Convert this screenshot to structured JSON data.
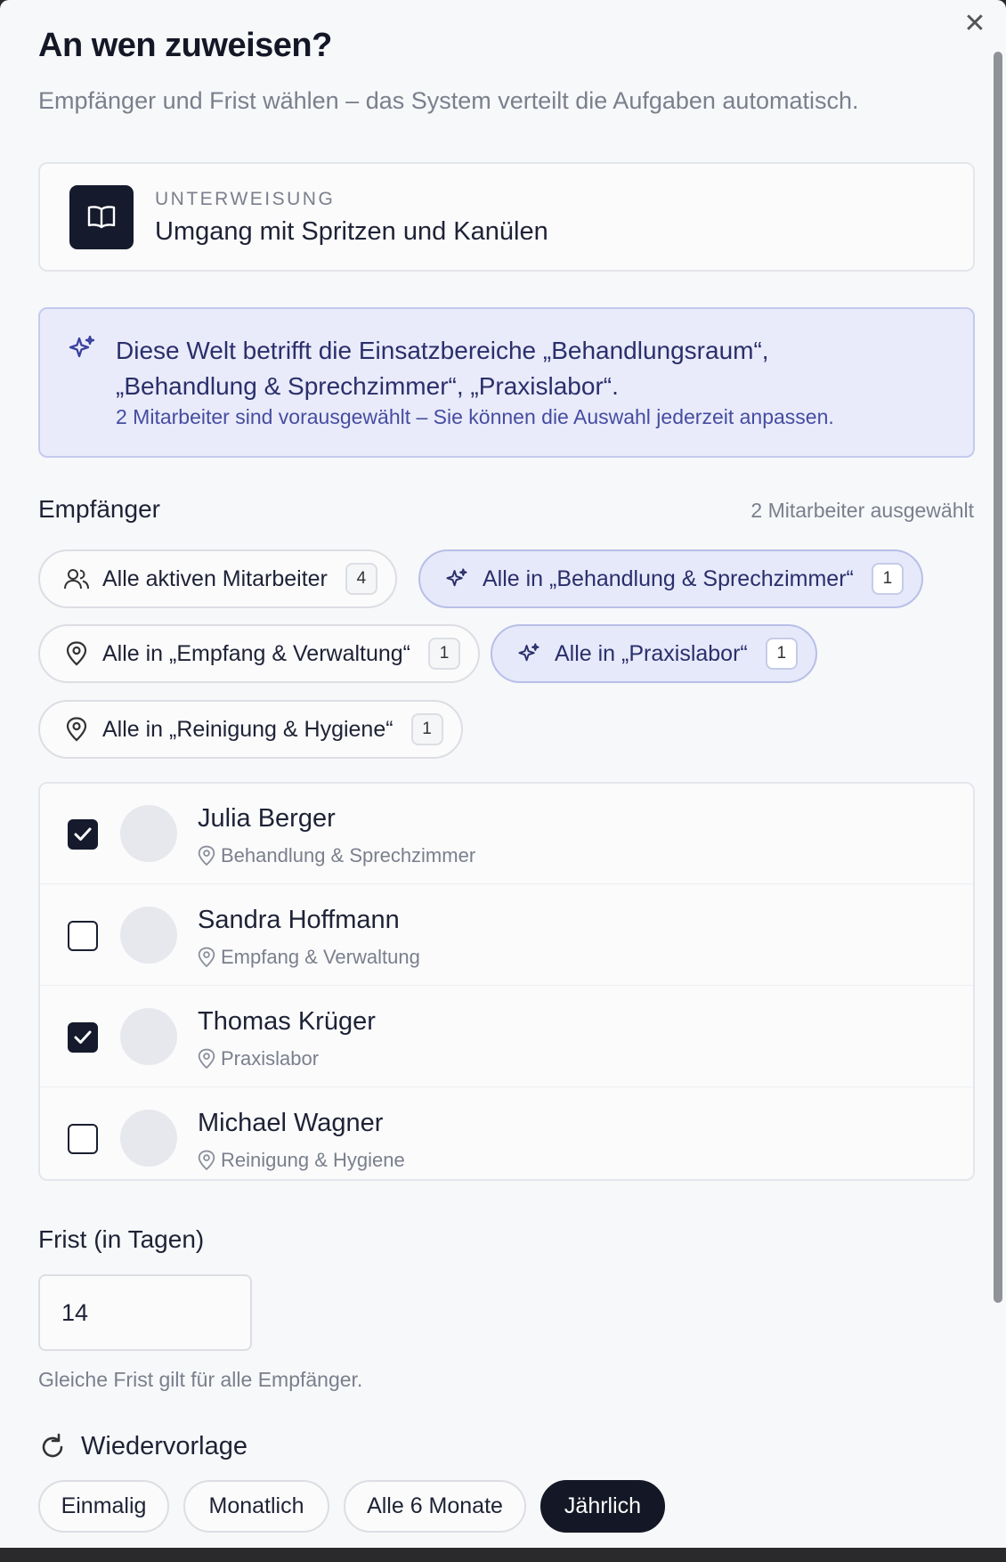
{
  "dialog": {
    "title": "An wen zuweisen?",
    "subtitle": "Empfänger und Frist wählen – das System verteilt die Aufgaben automatisch.",
    "close_icon": "close-icon"
  },
  "course": {
    "type": "UNTERWEISUNG",
    "name": "Umgang mit Spritzen und Kanülen",
    "icon": "book-open-icon"
  },
  "info": {
    "line1": "Diese Welt betrifft die Einsatzbereiche „Behandlungsraum“, „Behandlung & Sprechzimmer“, „Praxislabor“.",
    "line2": "2 Mitarbeiter sind vorausgewählt – Sie können die Auswahl jederzeit anpassen.",
    "icon": "sparkles-icon"
  },
  "recipients": {
    "label": "Empfänger",
    "selected_count": "2 Mitarbeiter ausgewählt",
    "chips": [
      {
        "label": "Alle aktiven Mitarbeiter",
        "count": "4",
        "icon": "users-icon",
        "active": false
      },
      {
        "label": "Alle in „Behandlung & Sprechzimmer“",
        "count": "1",
        "icon": "sparkles-icon",
        "active": true
      },
      {
        "label": "Alle in „Empfang & Verwaltung“",
        "count": "1",
        "icon": "map-pin-icon",
        "active": false
      },
      {
        "label": "Alle in „Praxislabor“",
        "count": "1",
        "icon": "sparkles-icon",
        "active": true
      },
      {
        "label": "Alle in „Reinigung & Hygiene“",
        "count": "1",
        "icon": "map-pin-icon",
        "active": false
      }
    ],
    "people": [
      {
        "name": "Julia Berger",
        "location": "Behandlung & Sprechzimmer",
        "checked": true
      },
      {
        "name": "Sandra Hoffmann",
        "location": "Empfang & Verwaltung",
        "checked": false
      },
      {
        "name": "Thomas Krüger",
        "location": "Praxislabor",
        "checked": true
      },
      {
        "name": "Michael Wagner",
        "location": "Reinigung & Hygiene",
        "checked": false
      }
    ]
  },
  "deadline": {
    "label": "Frist (in Tagen)",
    "value": "14",
    "hint": "Gleiche Frist gilt für alle Empfänger."
  },
  "recurrence": {
    "label": "Wiedervorlage",
    "icon": "refresh-icon",
    "options": [
      "Einmalig",
      "Monatlich",
      "Alle 6 Monate",
      "Jährlich"
    ],
    "selected": "Jährlich"
  },
  "colors": {
    "primary_dark": "#151a2c",
    "info_bg": "#e9ebfa",
    "info_border": "#c5caf0",
    "muted_text": "#7a7f8c"
  }
}
